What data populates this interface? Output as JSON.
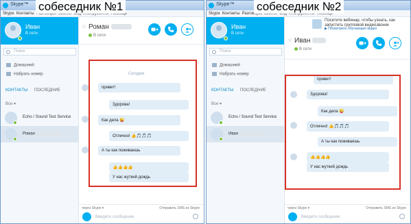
{
  "headings": {
    "left": "собеседник №1",
    "right": "собеседник №2"
  },
  "window_title": "Skype™",
  "menu": [
    "Skype",
    "Контакты",
    "Разговоры",
    "Звонки",
    "Вид",
    "Инструменты",
    "Помощь"
  ],
  "colors": {
    "skype_blue": "#00aff0",
    "highlight_red": "#d72f24",
    "online_green": "#7ac143",
    "bubble_blue": "#e1edf7"
  },
  "window1": {
    "profile": {
      "name": "Иван",
      "status": "В сети"
    },
    "search_placeholder": "Поиск",
    "nav": {
      "home": "Домашний",
      "dial": "Набрать номер"
    },
    "tabs": {
      "contacts": "КОНТАКТЫ",
      "recent": "ПОСЛЕДНИЕ"
    },
    "filter": "Все",
    "contacts": [
      {
        "name": "Echo / Sound Test Service"
      },
      {
        "name": "Роман"
      }
    ],
    "chat": {
      "title": "Роман",
      "status": "В сети",
      "date_label": "Сегодня",
      "messages": [
        {
          "text": "привет!"
        },
        {
          "text": "Здорова!"
        },
        {
          "text": "Как дела 😜"
        },
        {
          "text": "Отлично! 👍🎵🎵🎵"
        },
        {
          "text": "А ты как поживаешь"
        },
        {
          "text": "👍👍👍👍"
        },
        {
          "text": "У нас жуткий дождь"
        }
      ],
      "via": "через Skype ▾",
      "sms": "Отправить SMS из Skype",
      "placeholder": "Введите сообщение"
    }
  },
  "window2": {
    "ad": {
      "text": "Посетите вебинар, чтобы узнать, как запустить групповой видеозвонок",
      "link": "▶ Посмотреть обучающее видео"
    },
    "profile": {
      "name": "Иван",
      "status": "В сети"
    },
    "search_placeholder": "Поиск",
    "nav": {
      "home": "Домашний",
      "dial": "Набрать номер"
    },
    "tabs": {
      "contacts": "КОНТАКТЫ",
      "recent": "ПОСЛЕДНИЕ"
    },
    "filter": "Все",
    "contacts": [
      {
        "name": "Echo / Sound Test Service"
      },
      {
        "name": "Иван"
      }
    ],
    "chat": {
      "title": "Иван",
      "status": "В сети",
      "messages": [
        {
          "text": "привет!"
        },
        {
          "text": "Здорова!"
        },
        {
          "text": "Как дела 😜"
        },
        {
          "text": "Отлично! 👍🎵🎵🎵"
        },
        {
          "text": "А ты как поживаешь"
        },
        {
          "text": "👍👍👍👍"
        },
        {
          "text": "У нас жуткий дождь"
        }
      ],
      "via": "через Skype ▾",
      "sms": "Отправить SMS из Skype",
      "placeholder": "Введите сообщение"
    }
  }
}
